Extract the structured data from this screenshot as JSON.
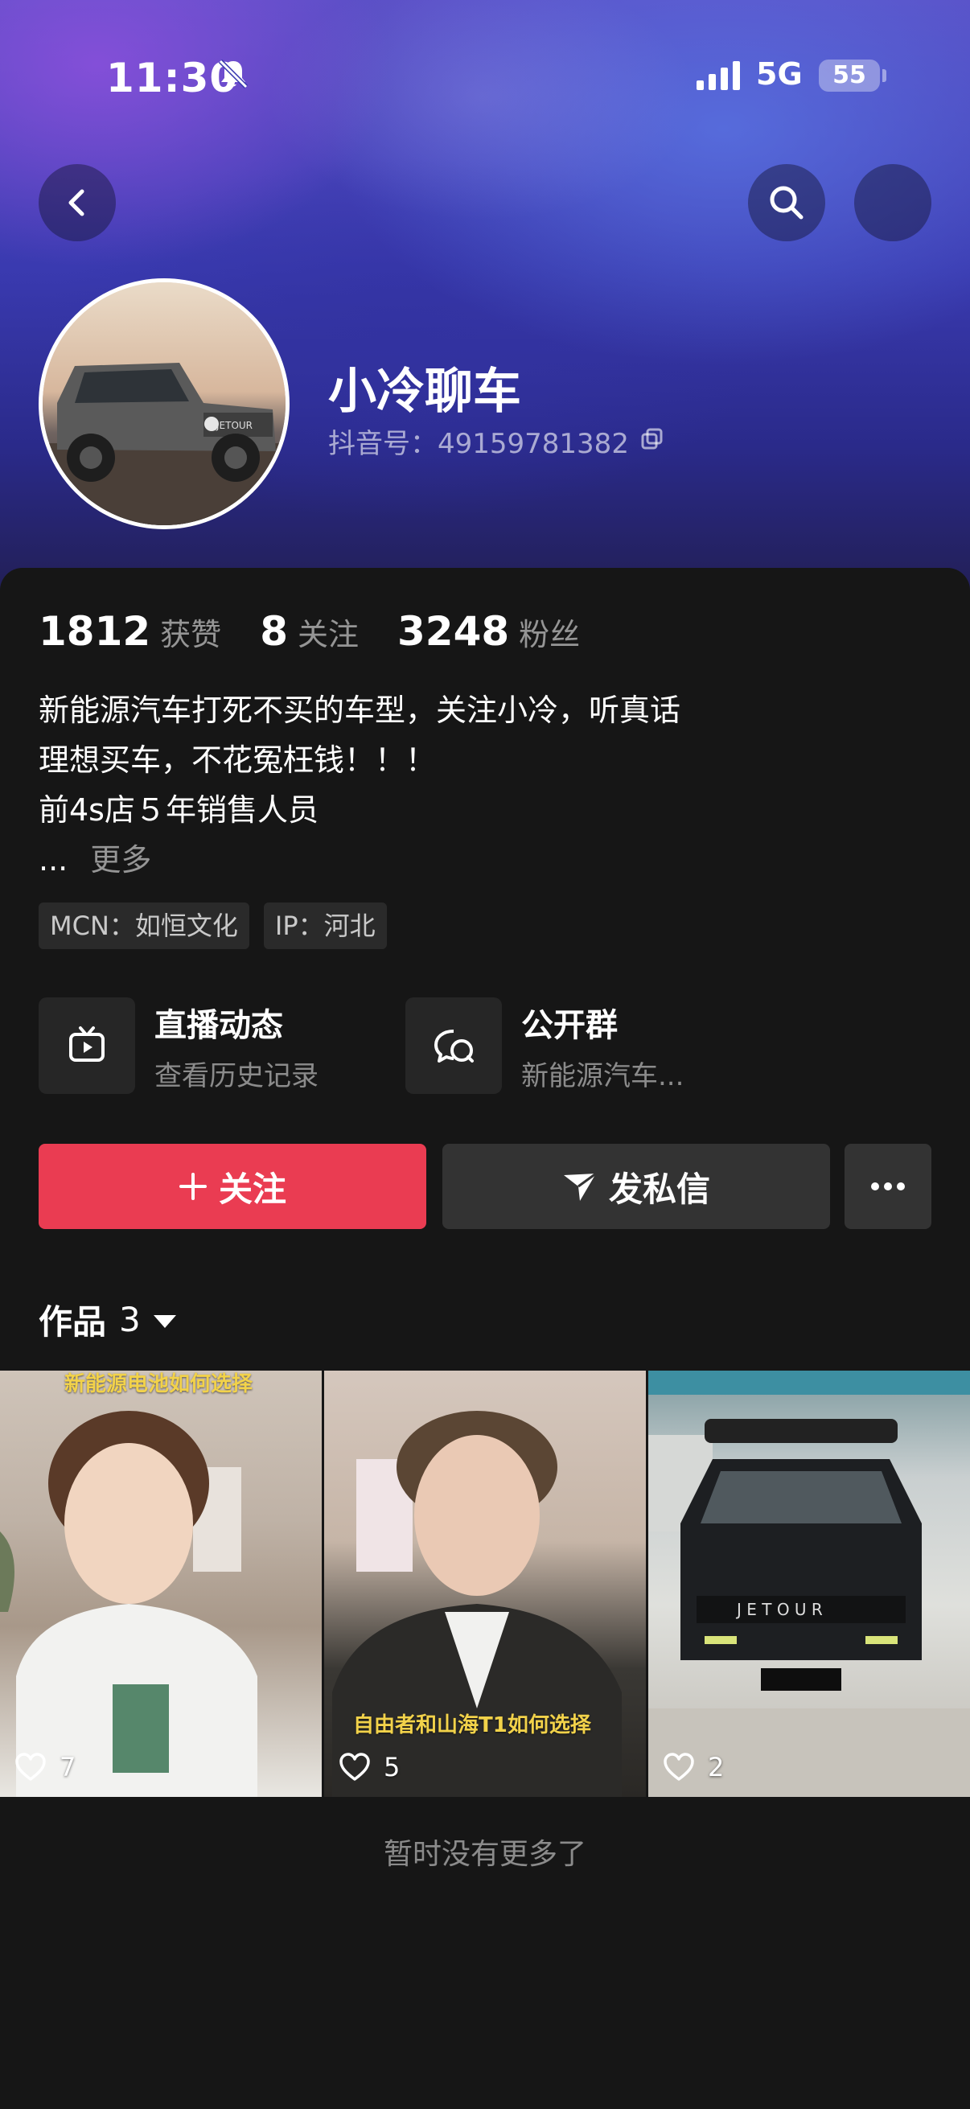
{
  "status_bar": {
    "time": "11:30",
    "network": "5G",
    "battery": "55"
  },
  "header": {
    "back_icon": "chevron-left-icon",
    "search_icon": "search-icon",
    "more_icon": "more-icon"
  },
  "profile": {
    "name": "小冷聊车",
    "douyin_id": "抖音号：49159781382"
  },
  "stats": [
    {
      "value": "1812",
      "label": "获赞"
    },
    {
      "value": "8",
      "label": "关注"
    },
    {
      "value": "3248",
      "label": "粉丝"
    }
  ],
  "bio": {
    "lines": [
      "新能源汽车打死不买的车型，关注小冷，听真话",
      "理想买车，不花冤枉钱！！！",
      "前4s店５年销售人员"
    ],
    "ellipsis": "...",
    "more": "更多"
  },
  "tags": [
    "MCN：如恒文化",
    "IP：河北"
  ],
  "features": {
    "live": {
      "title": "直播动态",
      "subtitle": "查看历史记录",
      "icon": "tv-icon"
    },
    "group": {
      "title": "公开群",
      "subtitle": "新能源汽车...",
      "icon": "chat-icon"
    }
  },
  "actions": {
    "follow": "关注",
    "message": "发私信",
    "more_icon": "ellipsis-icon"
  },
  "works": {
    "label": "作品",
    "count": "3",
    "items": [
      {
        "caption": "新能源电池如何选择",
        "likes": "7"
      },
      {
        "caption": "自由者和山海T1如何选择",
        "likes": "5"
      },
      {
        "caption": "",
        "likes": "2"
      }
    ]
  },
  "footer": {
    "no_more": "暂时没有更多了"
  },
  "colors": {
    "follow_button": "#ea3c52",
    "panel_bg": "#161616",
    "secondary_button": "#333333"
  }
}
